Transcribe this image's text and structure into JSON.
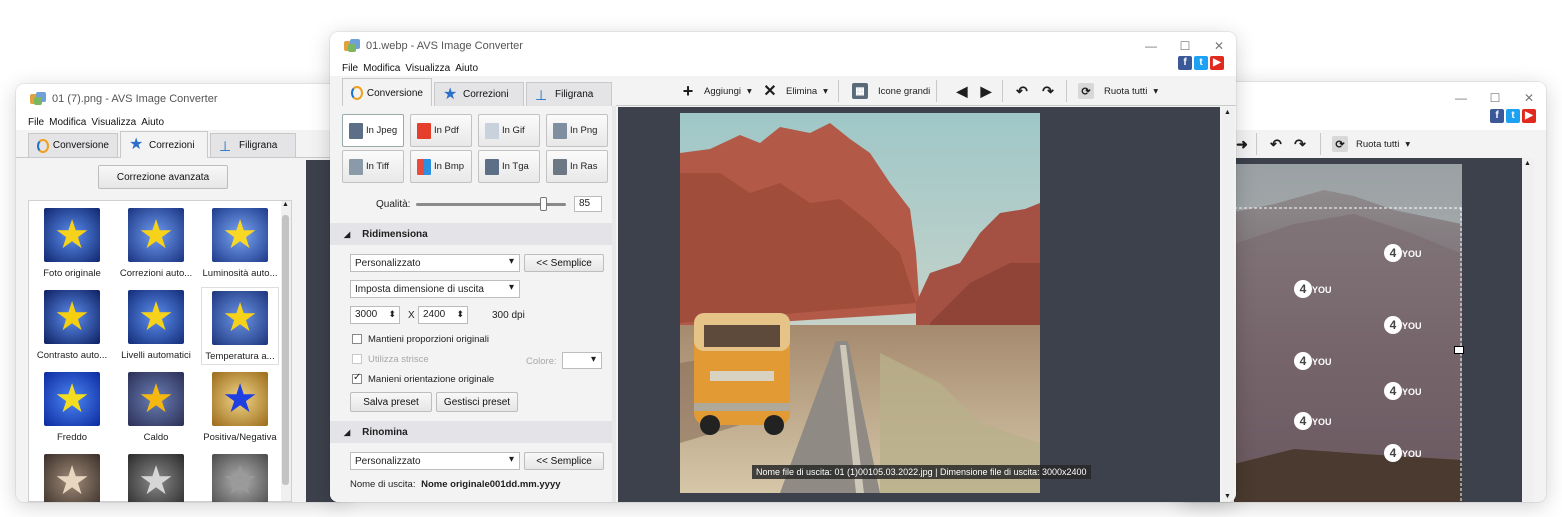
{
  "left_window": {
    "title": "01 (7).png - AVS Image Converter",
    "menu": [
      "File",
      "Modifica",
      "Visualizza",
      "Aiuto"
    ],
    "tabs": [
      "Conversione",
      "Correzioni",
      "Filigrana"
    ],
    "advanced_button": "Correzione avanzata",
    "effects": [
      "Foto originale",
      "Correzioni auto...",
      "Luminosità auto...",
      "Contrasto auto...",
      "Livelli automatici",
      "Temperatura a...",
      "Freddo",
      "Caldo",
      "Positiva/Negativa"
    ]
  },
  "main_window": {
    "title": "01.webp - AVS Image Converter",
    "menu": [
      "File",
      "Modifica",
      "Visualizza",
      "Aiuto"
    ],
    "tabs": [
      "Conversione",
      "Correzioni",
      "Filigrana"
    ],
    "toolbar": {
      "add": "Aggiungi",
      "delete": "Elimina",
      "large_icons": "Icone grandi",
      "rotate_all": "Ruota tutti"
    },
    "formats": [
      "In Jpeg",
      "In Pdf",
      "In Gif",
      "In Png",
      "In Tiff",
      "In Bmp",
      "In Tga",
      "In Ras"
    ],
    "quality_label": "Qualità:",
    "quality_value": "85",
    "quality_fraction": 0.85,
    "resize": {
      "header": "Ridimensiona",
      "preset": "Personalizzato",
      "simple_button": "<< Semplice",
      "output_size_mode": "Imposta dimensione di uscita",
      "width": "3000",
      "x_label": "X",
      "height": "2400",
      "dpi": "300 dpi",
      "keep_proportions": "Mantieni proporzioni originali",
      "use_stripes": "Utilizza strisce",
      "color_label": "Colore:",
      "keep_orientation": "Manieni orientazione originale",
      "save_preset": "Salva preset",
      "manage_presets": "Gestisci preset"
    },
    "rename": {
      "header": "Rinomina",
      "preset": "Personalizzato",
      "simple_button": "<< Semplice",
      "output_name_label": "Nome di uscita:",
      "output_name_value": "Nome originale001dd.mm.yyyy"
    },
    "preview_caption": "Nome file di uscita: 01 (1)00105.03.2022.jpg | Dimensione file di uscita: 3000x2400"
  },
  "right_window": {
    "toolbar": {
      "rotate_all": "Ruota tutti"
    },
    "watermark_text": "AVS4YOU"
  },
  "colors": {
    "accent_blue": "#1e73c8",
    "facebook": "#3b5998",
    "twitter": "#1da1f2",
    "youtube": "#e02a20",
    "preview_bg": "#3c414b"
  }
}
